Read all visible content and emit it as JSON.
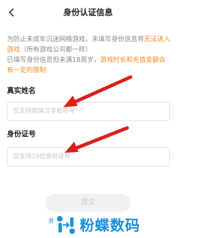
{
  "header": {
    "title": "身份认证信息"
  },
  "notice": {
    "line1_prefix": "为防止未成年沉迷网络游戏，未填写身份信息将",
    "line1_warn": "无法进入游戏",
    "line1_suffix": "（所有游戏公司都一样）",
    "line2_prefix": "已填写身份信息但未满18周岁，",
    "line2_warn": "游戏时长和充值金额会有一定的限制"
  },
  "form": {
    "name_label": "真实姓名",
    "name_placeholder": "仅支持简体汉字和符号“·”",
    "id_label": "身份证号",
    "id_placeholder": "仅支持18位身份证号"
  },
  "submit_label": "提交",
  "footer_link": "港",
  "watermark": {
    "text": "粉蝶数码",
    "icon": "butterfly-logo-icon"
  },
  "colors": {
    "warn": "#f08c1e",
    "arrow": "#d9201b",
    "watermark": "#1a8fe0"
  }
}
